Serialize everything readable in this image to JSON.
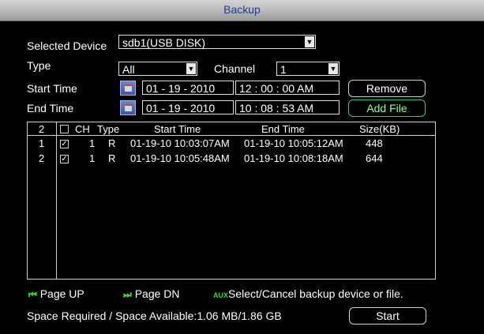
{
  "window": {
    "title": "Backup"
  },
  "device": {
    "label": "Selected Device",
    "value": "sdb1(USB DISK)"
  },
  "type": {
    "label": "Type",
    "value": "All"
  },
  "channel": {
    "label": "Channel",
    "value": "1"
  },
  "start_time": {
    "label": "Start Time",
    "date": "01 - 19 - 2010",
    "time": "12 : 00 : 00  AM"
  },
  "end_time": {
    "label": "End Time",
    "date": "01 - 19 - 2010",
    "time": "10 : 08 : 53  AM"
  },
  "buttons": {
    "remove": "Remove",
    "add_file": "Add File",
    "start": "Start"
  },
  "table": {
    "count": "2",
    "headers": {
      "ch": "CH",
      "type": "Type",
      "start": "Start Time",
      "end": "End Time",
      "size": "Size(KB)"
    },
    "rows": [
      {
        "no": "1",
        "checked": "✓",
        "ch": "1",
        "type": "R",
        "start": "01-19-10 10:03:07AM",
        "end": "01-19-10 10:05:12AM",
        "size": "448"
      },
      {
        "no": "2",
        "checked": "✓",
        "ch": "1",
        "type": "R",
        "start": "01-19-10 10:05:48AM",
        "end": "01-19-10 10:08:18AM",
        "size": "644"
      }
    ]
  },
  "footer": {
    "page_up": "Page UP",
    "page_dn": "Page DN",
    "aux_tag": "AUX",
    "aux_hint": "Select/Cancel backup device or file.",
    "space": "Space Required / Space Available:1.06 MB/1.86 GB"
  },
  "icons": {
    "page_up": "skip-back-icon",
    "page_dn": "skip-forward-icon",
    "calendar": "calendar-icon",
    "dropdown": "chevron-down-icon"
  },
  "colors": {
    "title_bar": "#c0c0c0",
    "title_text": "#1a3b8c",
    "accent_green": "#33dd33"
  }
}
